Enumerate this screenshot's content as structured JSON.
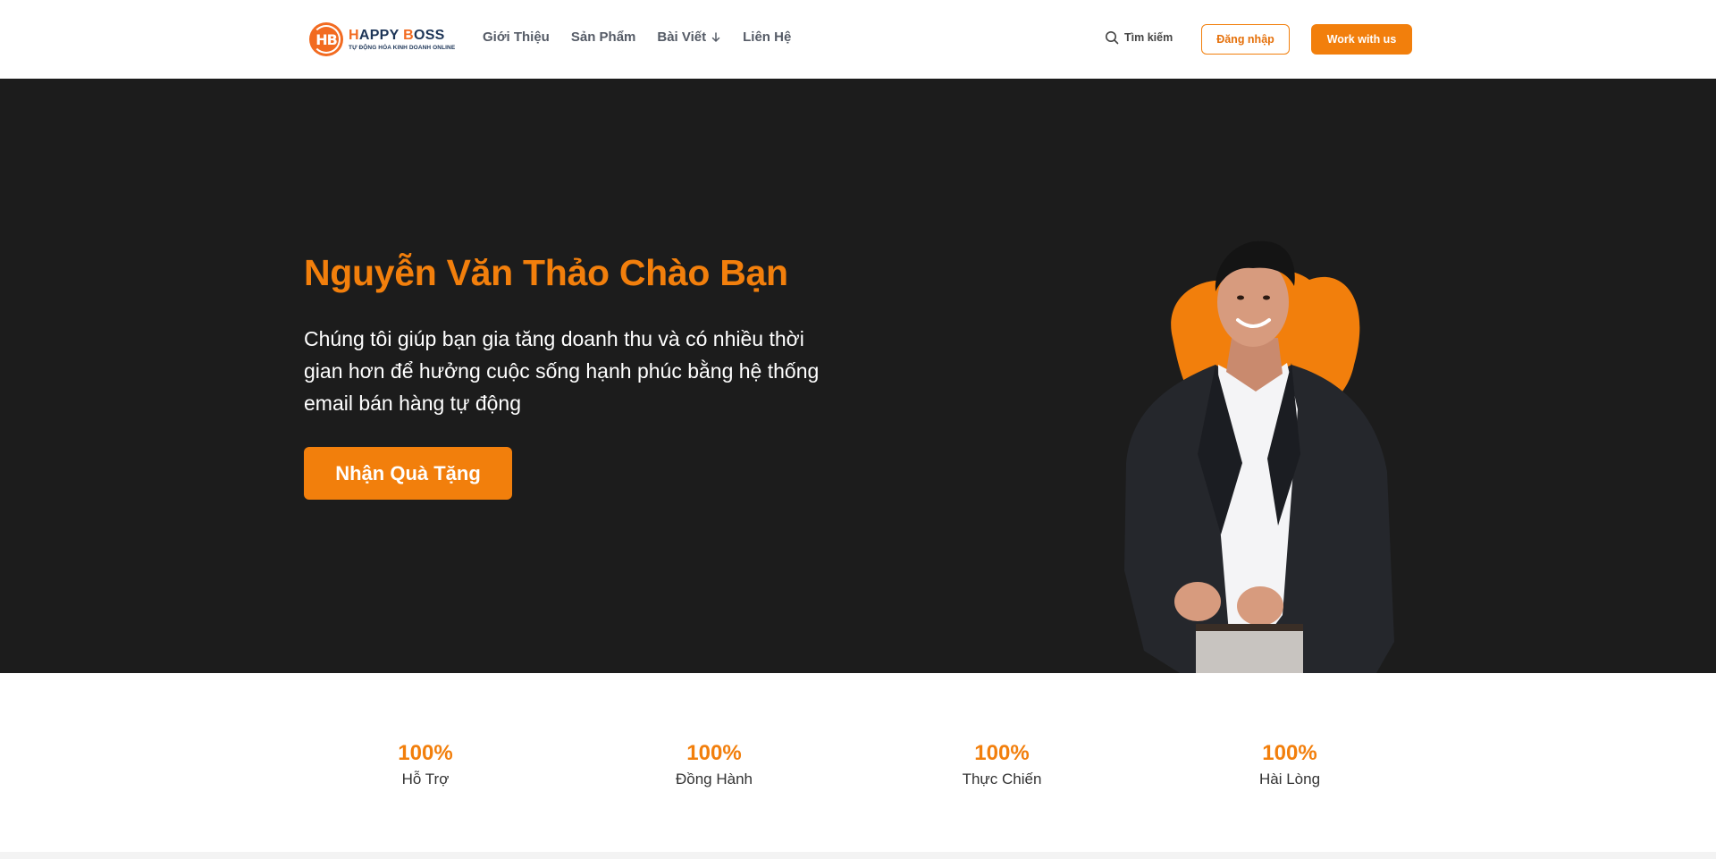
{
  "brand": {
    "mark": "HB",
    "name_first": "H",
    "name_mid": "APPY ",
    "name_b": "B",
    "name_rest": "OSS",
    "tagline": "TỰ ĐỘNG HÓA KINH DOANH ONLINE",
    "accent": "#f27f0c"
  },
  "nav": {
    "items": [
      {
        "label": "Giới Thiệu"
      },
      {
        "label": "Sản Phẩm"
      },
      {
        "label": "Bài Viết"
      },
      {
        "label": "Liên Hệ"
      }
    ]
  },
  "header": {
    "search_label": "Tìm kiếm",
    "login_label": "Đăng nhập",
    "work_label": "Work with us"
  },
  "hero": {
    "title": "Nguyễn Văn Thảo Chào Bạn",
    "description": "Chúng tôi giúp bạn gia tăng doanh thu và có nhiều thời gian hơn để hưởng cuộc sống hạnh phúc bằng hệ thống email bán hàng tự động",
    "cta_label": "Nhận Quà Tặng",
    "background": "#1c1c1c"
  },
  "stats": [
    {
      "value": "100%",
      "label": "Hỗ Trợ"
    },
    {
      "value": "100%",
      "label": "Đồng Hành"
    },
    {
      "value": "100%",
      "label": "Thực Chiến"
    },
    {
      "value": "100%",
      "label": "Hài Lòng"
    }
  ]
}
